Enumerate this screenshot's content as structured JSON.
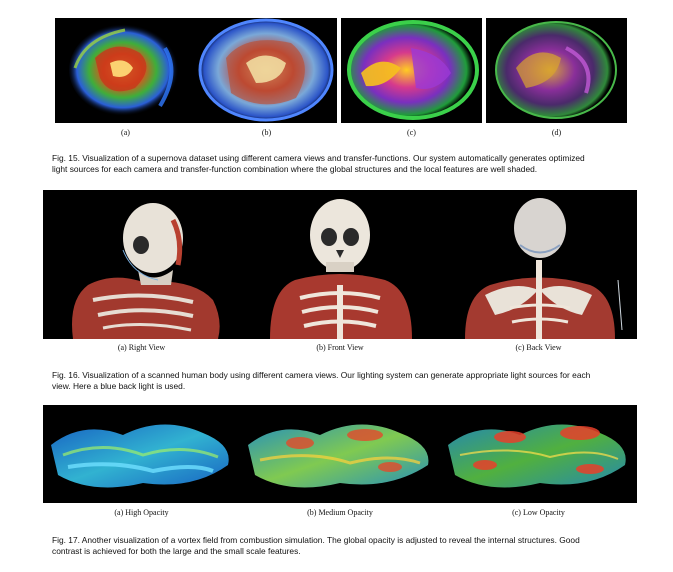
{
  "fig15": {
    "labels": [
      "(a)",
      "(b)",
      "(c)",
      "(d)"
    ],
    "caption_lines": [
      "Fig. 15.  Visualization of a supernova dataset using different camera views and transfer-functions.  Our system automatically generates optimized",
      "light sources for each camera and transfer-function combination where the global structures and the local features are well shaded."
    ]
  },
  "fig16": {
    "labels": [
      "(a) Right View",
      "(b) Front View",
      "(c) Back View"
    ],
    "caption_lines": [
      "Fig. 16.  Visualization of a scanned human body using different camera views. Our lighting system can generate appropriate light sources for each",
      "view. Here a blue back light is used."
    ]
  },
  "fig17": {
    "labels": [
      "(a) High Opacity",
      "(b) Medium Opacity",
      "(c) Low Opacity"
    ],
    "caption_lines": [
      "Fig. 17.  Another visualization of a vortex field from combustion simulation.  The global opacity is adjusted to reveal the internal structures.  Good",
      "contrast is achieved for both the large and the small scale features."
    ]
  }
}
